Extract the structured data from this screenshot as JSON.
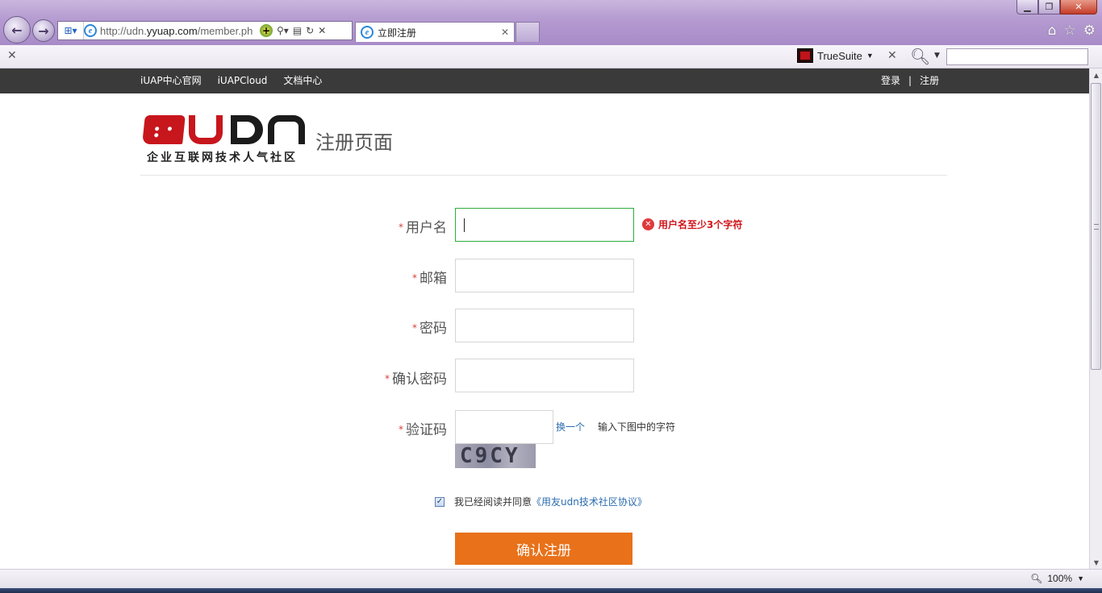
{
  "browser": {
    "url_prefix": "http://udn.",
    "url_domain": "yyuap.com",
    "url_rest": "/member.ph",
    "tab_title": "立即注册",
    "truesuite_label": "TrueSuite",
    "zoom": "100%"
  },
  "topnav": {
    "links": [
      "iUAP中心官网",
      "iUAPCloud",
      "文档中心"
    ],
    "login": "登录",
    "separator": "|",
    "register": "注册"
  },
  "header": {
    "logo_tagline": "企业互联网技术人气社区",
    "page_title": "注册页面"
  },
  "form": {
    "required_mark": "*",
    "username_label": "用户名",
    "username_error": "用户名至少3个字符",
    "email_label": "邮箱",
    "password_label": "密码",
    "confirm_label": "确认密码",
    "captcha_label": "验证码",
    "captcha_refresh": "换一个",
    "captcha_hint": "输入下图中的字符",
    "captcha_text": "C9CY",
    "agree_text": "我已经阅读并同意",
    "agree_link": "《用友udn技术社区协议》",
    "submit_label": "确认注册"
  },
  "colors": {
    "accent": "#e8711a",
    "error": "#d0141a",
    "brand_red": "#c8161d",
    "nav_bg": "#3a3a3a"
  }
}
